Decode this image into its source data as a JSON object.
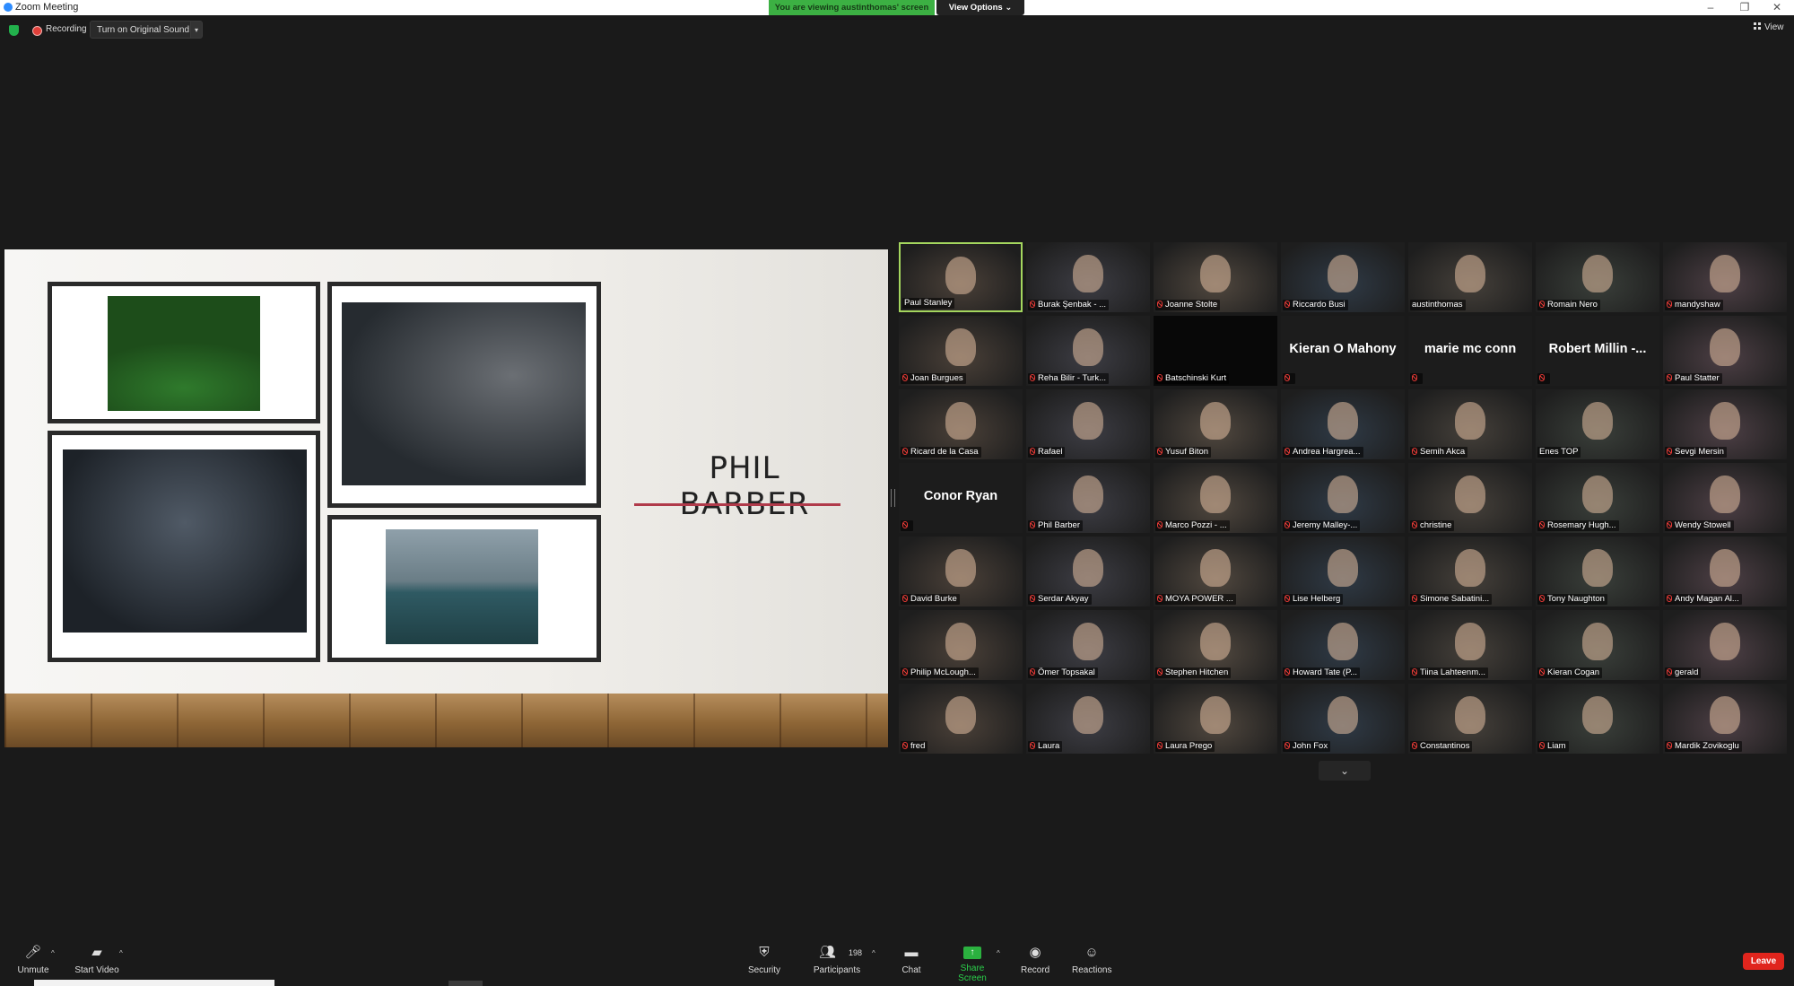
{
  "window": {
    "title": "Zoom Meeting",
    "controls": [
      "–",
      "❐",
      "✕"
    ]
  },
  "banner": {
    "text": "You are viewing austinthomas' screen",
    "view_options": "View Options ⌄"
  },
  "top_bar": {
    "recording": "Recording",
    "original_sound": "Turn on Original Sound",
    "caret": "▾",
    "view": "View"
  },
  "slide": {
    "title": "PHIL BARBER",
    "accent_color": "#b03a4a"
  },
  "participants": [
    {
      "name": "Paul Stanley",
      "muted": false,
      "active": true
    },
    {
      "name": "Burak Şenbak - ...",
      "muted": true
    },
    {
      "name": "Joanne Stolte",
      "muted": true
    },
    {
      "name": "Riccardo Busi",
      "muted": true
    },
    {
      "name": "austinthomas",
      "muted": false
    },
    {
      "name": "Romain Nero",
      "muted": true
    },
    {
      "name": "mandyshaw",
      "muted": true
    },
    {
      "name": "Joan Burgues",
      "muted": true
    },
    {
      "name": "Reha Bilir - Turk...",
      "muted": true
    },
    {
      "name": "Batschinski Kurt",
      "muted": true,
      "no_video": true
    },
    {
      "name": "",
      "muted": true,
      "name_only": "Kieran O Mahony"
    },
    {
      "name": "",
      "muted": true,
      "name_only": "marie mc conn"
    },
    {
      "name": "",
      "muted": true,
      "name_only": "Robert Millin -..."
    },
    {
      "name": "Paul Statter",
      "muted": true
    },
    {
      "name": "Ricard de la Casa",
      "muted": true
    },
    {
      "name": "Rafael",
      "muted": true
    },
    {
      "name": "Yusuf Biton",
      "muted": true
    },
    {
      "name": "Andrea Hargrea...",
      "muted": true
    },
    {
      "name": "Semih Akca",
      "muted": true
    },
    {
      "name": "Enes TOP",
      "muted": false
    },
    {
      "name": "Sevgi Mersin",
      "muted": true
    },
    {
      "name": "",
      "muted": true,
      "name_only": "Conor Ryan"
    },
    {
      "name": "Phil Barber",
      "muted": true
    },
    {
      "name": "Marco Pozzi - ...",
      "muted": true
    },
    {
      "name": "Jeremy Malley-...",
      "muted": true
    },
    {
      "name": "christine",
      "muted": true
    },
    {
      "name": "Rosemary Hugh...",
      "muted": true
    },
    {
      "name": "Wendy Stowell",
      "muted": true
    },
    {
      "name": "David Burke",
      "muted": true
    },
    {
      "name": "Serdar Akyay",
      "muted": true
    },
    {
      "name": "MOYA POWER ...",
      "muted": true
    },
    {
      "name": "Lise Helberg",
      "muted": true
    },
    {
      "name": "Simone Sabatini...",
      "muted": true
    },
    {
      "name": "Tony Naughton",
      "muted": true
    },
    {
      "name": "Andy Magan Al...",
      "muted": true
    },
    {
      "name": "Philip McLough...",
      "muted": true
    },
    {
      "name": "Ömer Topsakal",
      "muted": true
    },
    {
      "name": "Stephen Hitchen",
      "muted": true
    },
    {
      "name": "Howard Tate (P...",
      "muted": true
    },
    {
      "name": "Tiina Lahteenm...",
      "muted": true
    },
    {
      "name": "Kieran Cogan",
      "muted": true
    },
    {
      "name": "gerald",
      "muted": true
    },
    {
      "name": "fred",
      "muted": true
    },
    {
      "name": "Laura",
      "muted": true
    },
    {
      "name": "Laura Prego",
      "muted": true
    },
    {
      "name": "John Fox",
      "muted": true
    },
    {
      "name": "Constantinos",
      "muted": true
    },
    {
      "name": "Liam",
      "muted": true
    },
    {
      "name": "Mardik Zovikoglu",
      "muted": true
    }
  ],
  "gallery": {
    "next_page": "⌄"
  },
  "controls": {
    "unmute": "Unmute",
    "start_video": "Start Video",
    "security": "Security",
    "participants": "Participants",
    "participant_count": "198",
    "chat": "Chat",
    "share_screen": "Share Screen",
    "record": "Record",
    "reactions": "Reactions",
    "leave": "Leave",
    "caret": "^"
  },
  "colors": {
    "active_speaker": "#a4d65e",
    "share_green": "#2bb13f",
    "leave_red": "#e0251d",
    "banner_green": "#3cb043"
  }
}
